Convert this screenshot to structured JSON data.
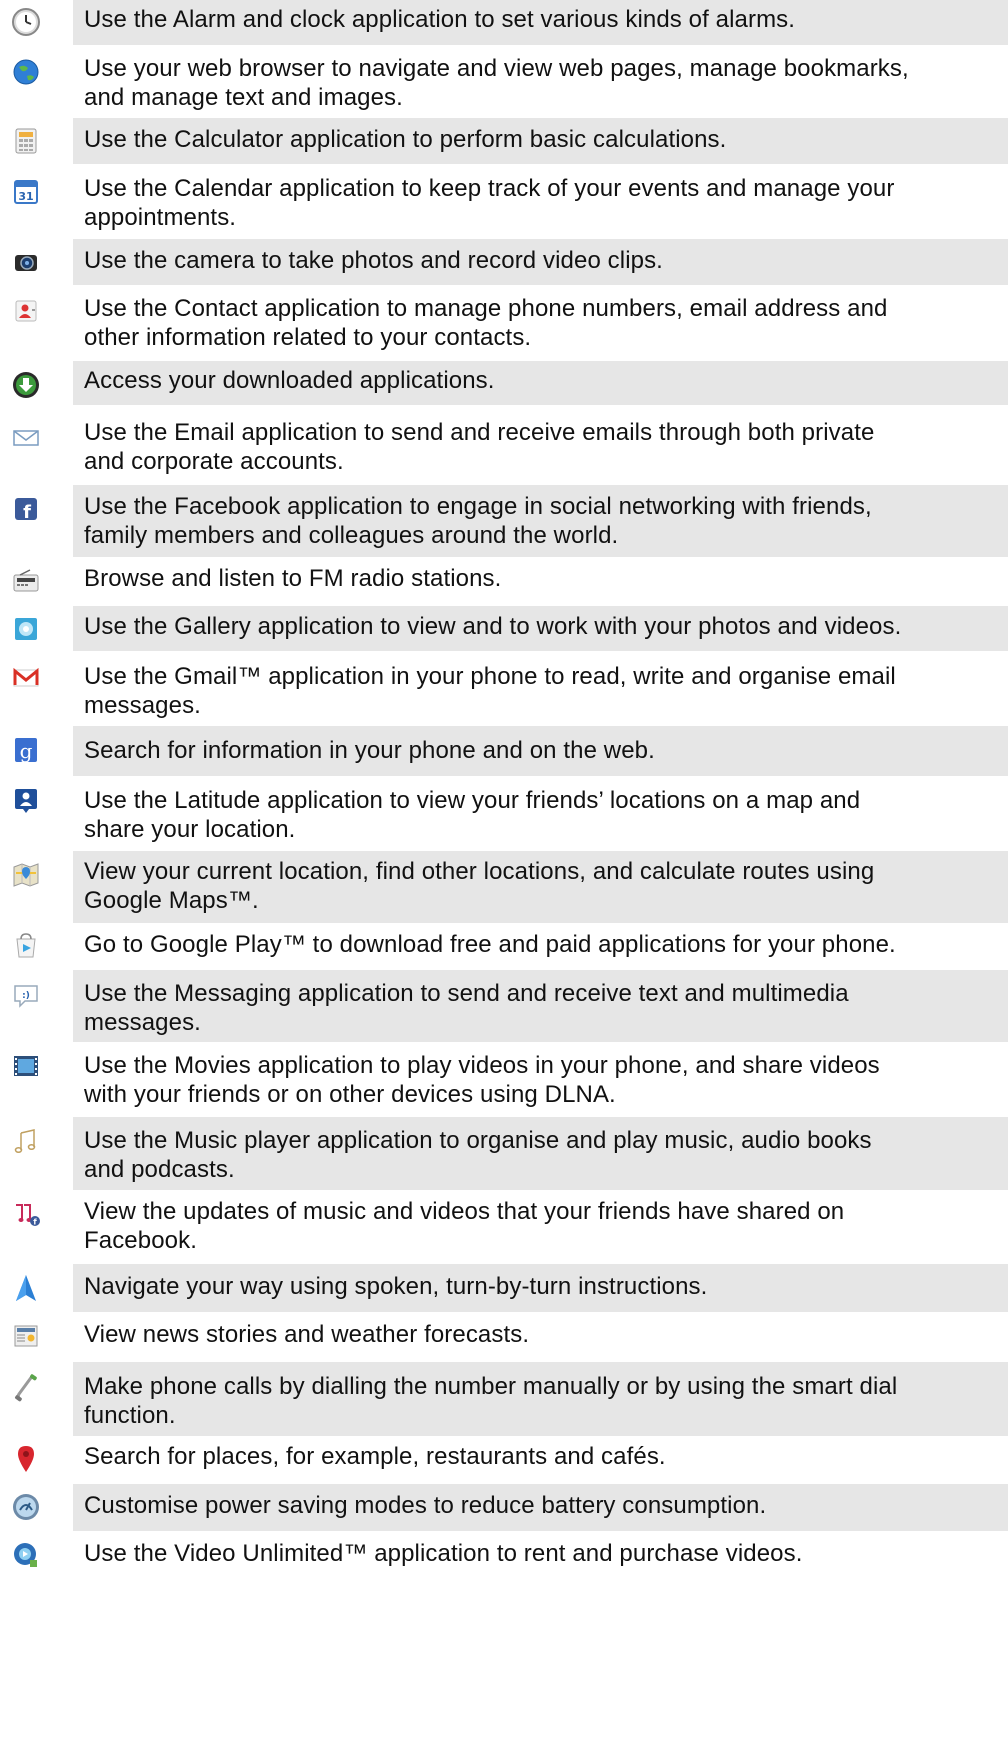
{
  "apps": [
    {
      "icon": "alarm-clock-icon",
      "text": "Use the Alarm and clock application to set various kinds of alarms."
    },
    {
      "icon": "browser-globe-icon",
      "text": "Use your web browser to navigate and view web pages, manage bookmarks,\nand manage text and images."
    },
    {
      "icon": "calculator-icon",
      "text": "Use the Calculator application to perform basic calculations."
    },
    {
      "icon": "calendar-icon",
      "text": "Use the Calendar application to keep track of your events and manage your\nappointments."
    },
    {
      "icon": "camera-icon",
      "text": "Use the camera to take photos and record video clips."
    },
    {
      "icon": "contacts-icon",
      "text": "Use the Contact application to manage phone numbers, email address and\nother information related to your contacts."
    },
    {
      "icon": "download-icon",
      "text": "Access your downloaded applications."
    },
    {
      "icon": "email-envelope-icon",
      "text": "Use the Email application to send and receive emails through both private\nand corporate accounts."
    },
    {
      "icon": "facebook-icon",
      "text": "Use the Facebook application to engage in social networking with friends,\nfamily members and colleagues around the world."
    },
    {
      "icon": "fm-radio-icon",
      "text": "Browse and listen to FM radio stations."
    },
    {
      "icon": "gallery-icon",
      "text": "Use the Gallery application to view and to work with your photos and videos."
    },
    {
      "icon": "gmail-icon",
      "text": "Use the Gmail™ application in your phone to read, write and organise email\nmessages."
    },
    {
      "icon": "google-search-icon",
      "text": "Search for information in your phone and on the web."
    },
    {
      "icon": "latitude-icon",
      "text": "Use the Latitude application to view your friends’ locations on a map and\nshare your location."
    },
    {
      "icon": "maps-icon",
      "text": "View your current location, find other locations, and calculate routes using\nGoogle Maps™."
    },
    {
      "icon": "play-store-icon",
      "text": "Go to Google Play™ to download free and paid applications for your phone."
    },
    {
      "icon": "messaging-icon",
      "text": "Use the Messaging application to send and receive text and multimedia\nmessages."
    },
    {
      "icon": "movies-icon",
      "text": "Use the Movies application to play videos in your phone, and share videos\nwith your friends or on other devices using DLNA."
    },
    {
      "icon": "music-note-icon",
      "text": "Use the Music player application to organise and play music, audio books\nand podcasts."
    },
    {
      "icon": "music-friends-icon",
      "text": "View the updates of music and videos that your friends have shared on\nFacebook."
    },
    {
      "icon": "navigation-arrow-icon",
      "text": "Navigate your way using spoken, turn-by-turn instructions."
    },
    {
      "icon": "news-weather-icon",
      "text": "View news stories and weather forecasts."
    },
    {
      "icon": "phone-handset-icon",
      "text": "Make phone calls by dialling the number manually or by using the smart dial\nfunction."
    },
    {
      "icon": "places-pin-icon",
      "text": "Search for places, for example, restaurants and cafés."
    },
    {
      "icon": "power-saver-icon",
      "text": "Customise power saving modes to reduce battery consumption."
    },
    {
      "icon": "video-unlimited-icon",
      "text": "Use the Video Unlimited™ application to rent and purchase videos."
    }
  ]
}
